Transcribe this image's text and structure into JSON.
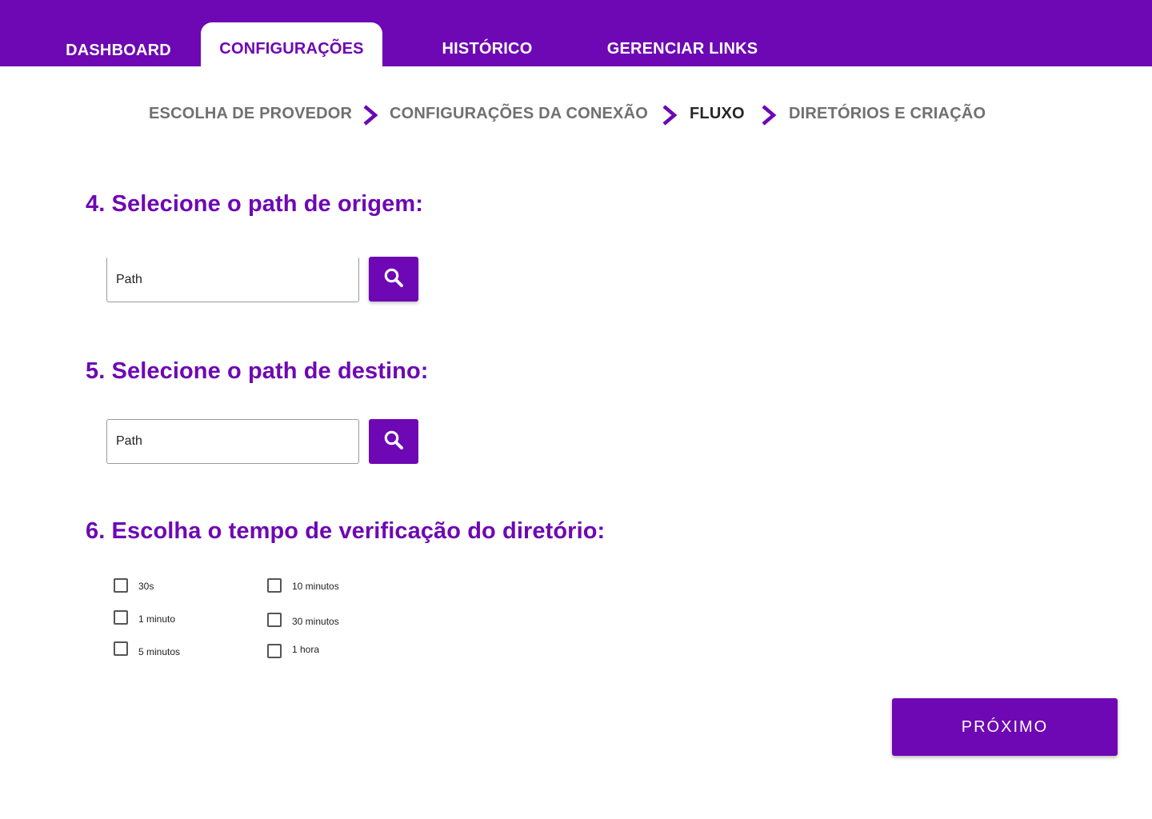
{
  "nav": {
    "tabs": [
      {
        "label": "DASHBOARD"
      },
      {
        "label": "CONFIGURAÇÕES",
        "active": true
      },
      {
        "label": "HISTÓRICO"
      },
      {
        "label": "GERENCIAR LINKS"
      }
    ]
  },
  "steps": [
    {
      "label": "ESCOLHA DE PROVEDOR"
    },
    {
      "label": "CONFIGURAÇÕES DA CONEXÃO"
    },
    {
      "label": "FLUXO",
      "current": true
    },
    {
      "label": "DIRETÓRIOS E CRIAÇÃO"
    }
  ],
  "origin": {
    "heading": "4. Selecione o path de origem:",
    "placeholder": "Path",
    "icon": "search-icon"
  },
  "destination": {
    "heading": "5. Selecione o path de destino:",
    "placeholder": "Path",
    "icon": "search-icon"
  },
  "interval": {
    "heading": "6. Escolha o tempo de verificação do diretório:",
    "options": [
      "30s",
      "1 minuto",
      "5 minutos",
      "10 minutos",
      "30 minutos",
      "1 hora"
    ]
  },
  "next_label": "PRÓXIMO",
  "colors": {
    "accent": "#6e07b4",
    "step_inactive": "#707070",
    "step_current": "#262626"
  }
}
